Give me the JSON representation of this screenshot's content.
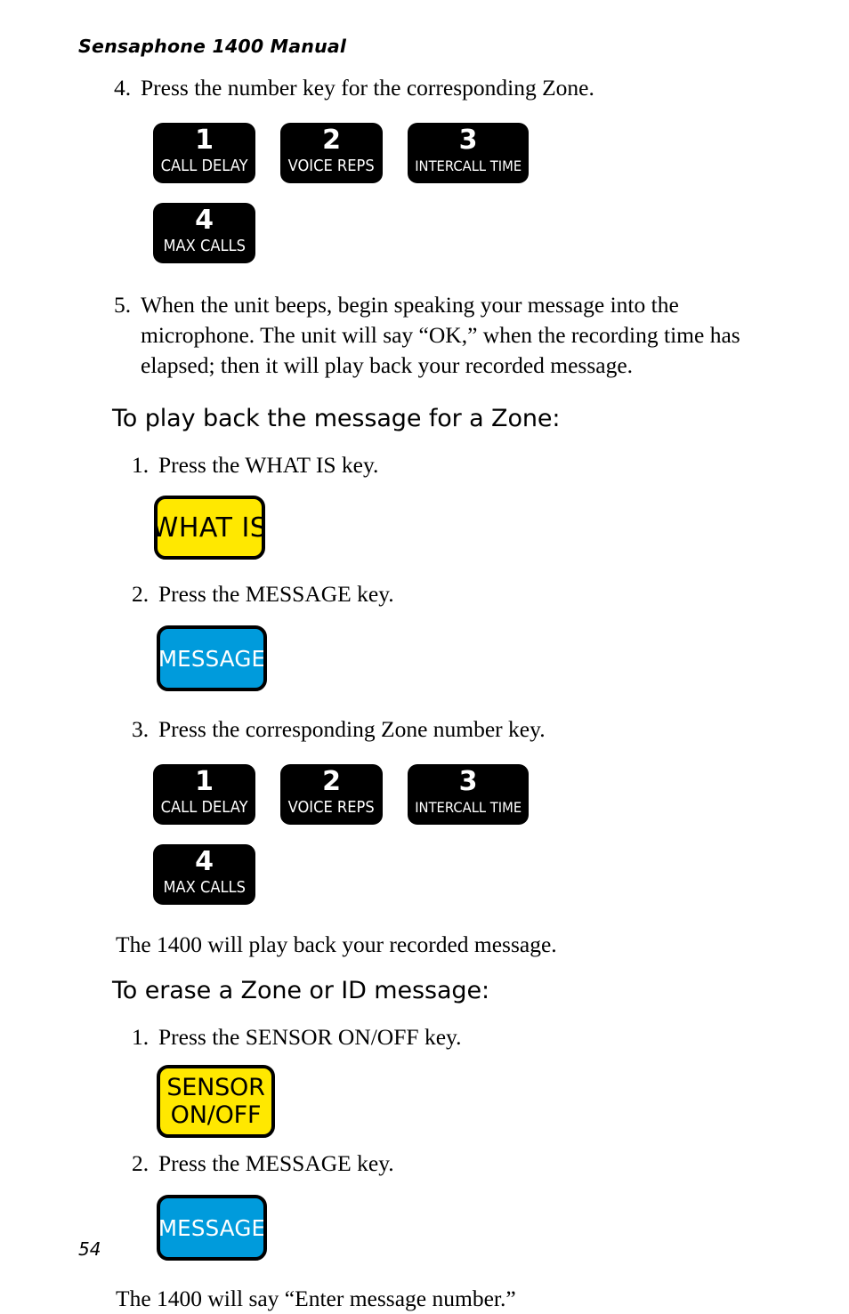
{
  "document": {
    "running_head": "Sensaphone 1400 Manual",
    "page_number": "54"
  },
  "colors": {
    "key_black_bg": "#000000",
    "key_black_text": "#FFFFFF",
    "key_yellow_bg": "#FFE800",
    "key_yellow_text": "#000000",
    "key_blue_bg": "#009BDC",
    "key_blue_text": "#FFFFFF",
    "key_border": "#000000",
    "body_text": "#000000",
    "page_bg": "#FFFFFF"
  },
  "zone_keys": [
    {
      "number": "1",
      "label": "CALL DELAY"
    },
    {
      "number": "2",
      "label": "VOICE REPS"
    },
    {
      "number": "3",
      "label": "INTERCALL TIME"
    },
    {
      "number": "4",
      "label": "MAX CALLS"
    }
  ],
  "sections": {
    "record": {
      "step4": {
        "num": "4.",
        "text": "Press the number key for the corresponding Zone."
      },
      "step5": {
        "num": "5.",
        "text": "When the unit beeps, begin speaking your message into the microphone. The unit will say “OK,” when the recording time has elapsed; then it will play back your recorded message."
      }
    },
    "playback": {
      "heading": "To play back the message for a Zone:",
      "step1": {
        "num": "1.",
        "text": "Press the WHAT IS key."
      },
      "step2": {
        "num": "2.",
        "text": "Press the MESSAGE key."
      },
      "step3": {
        "num": "3.",
        "text": "Press the corresponding Zone number key."
      },
      "closing": "The 1400 will play back your recorded message."
    },
    "erase": {
      "heading": "To erase a Zone or ID message:",
      "step1": {
        "num": "1.",
        "text": "Press the SENSOR ON/OFF key."
      },
      "step2": {
        "num": "2.",
        "text": "Press the MESSAGE key."
      },
      "closing": "The 1400 will say “Enter message number.”"
    }
  },
  "function_keys": {
    "what_is": {
      "line1": "WHAT IS"
    },
    "message": {
      "line1": "MESSAGE"
    },
    "sensor_on_off": {
      "line1": "SENSOR",
      "line2": "ON/OFF"
    }
  }
}
